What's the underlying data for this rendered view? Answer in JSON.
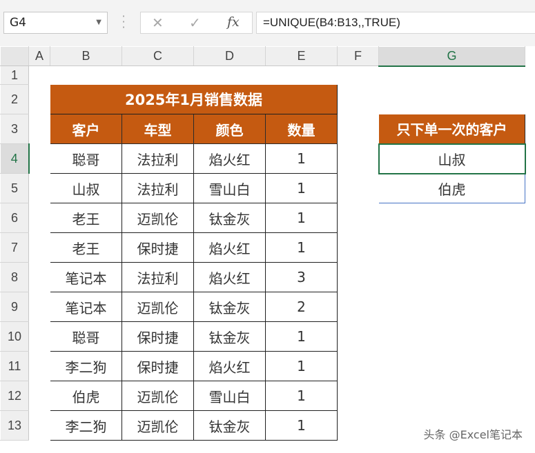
{
  "name_box": "G4",
  "formula_bar": {
    "cancel_glyph": "✕",
    "enter_glyph": "✓",
    "fx_glyph": "fx",
    "formula": "=UNIQUE(B4:B13,,TRUE)"
  },
  "columns": [
    "A",
    "B",
    "C",
    "D",
    "E",
    "F",
    "G"
  ],
  "rows": [
    "1",
    "2",
    "3",
    "4",
    "5",
    "6",
    "7",
    "8",
    "9",
    "10",
    "11",
    "12",
    "13"
  ],
  "selected_cell": "G4",
  "sales_table": {
    "title": "2025年1月销售数据",
    "headers": [
      "客户",
      "车型",
      "颜色",
      "数量"
    ],
    "rows": [
      [
        "聪哥",
        "法拉利",
        "焰火红",
        "1"
      ],
      [
        "山叔",
        "法拉利",
        "雪山白",
        "1"
      ],
      [
        "老王",
        "迈凯伦",
        "钛金灰",
        "1"
      ],
      [
        "老王",
        "保时捷",
        "焰火红",
        "1"
      ],
      [
        "笔记本",
        "法拉利",
        "焰火红",
        "3"
      ],
      [
        "笔记本",
        "迈凯伦",
        "钛金灰",
        "2"
      ],
      [
        "聪哥",
        "保时捷",
        "钛金灰",
        "1"
      ],
      [
        "李二狗",
        "保时捷",
        "焰火红",
        "1"
      ],
      [
        "伯虎",
        "迈凯伦",
        "雪山白",
        "1"
      ],
      [
        "李二狗",
        "迈凯伦",
        "钛金灰",
        "1"
      ]
    ]
  },
  "result": {
    "header": "只下单一次的客户",
    "values": [
      "山叔",
      "伯虎"
    ]
  },
  "watermark": "头条 @Excel笔记本",
  "colors": {
    "header_fill": "#c55a11",
    "selection_green": "#217346",
    "spill_border": "#4472c4"
  }
}
